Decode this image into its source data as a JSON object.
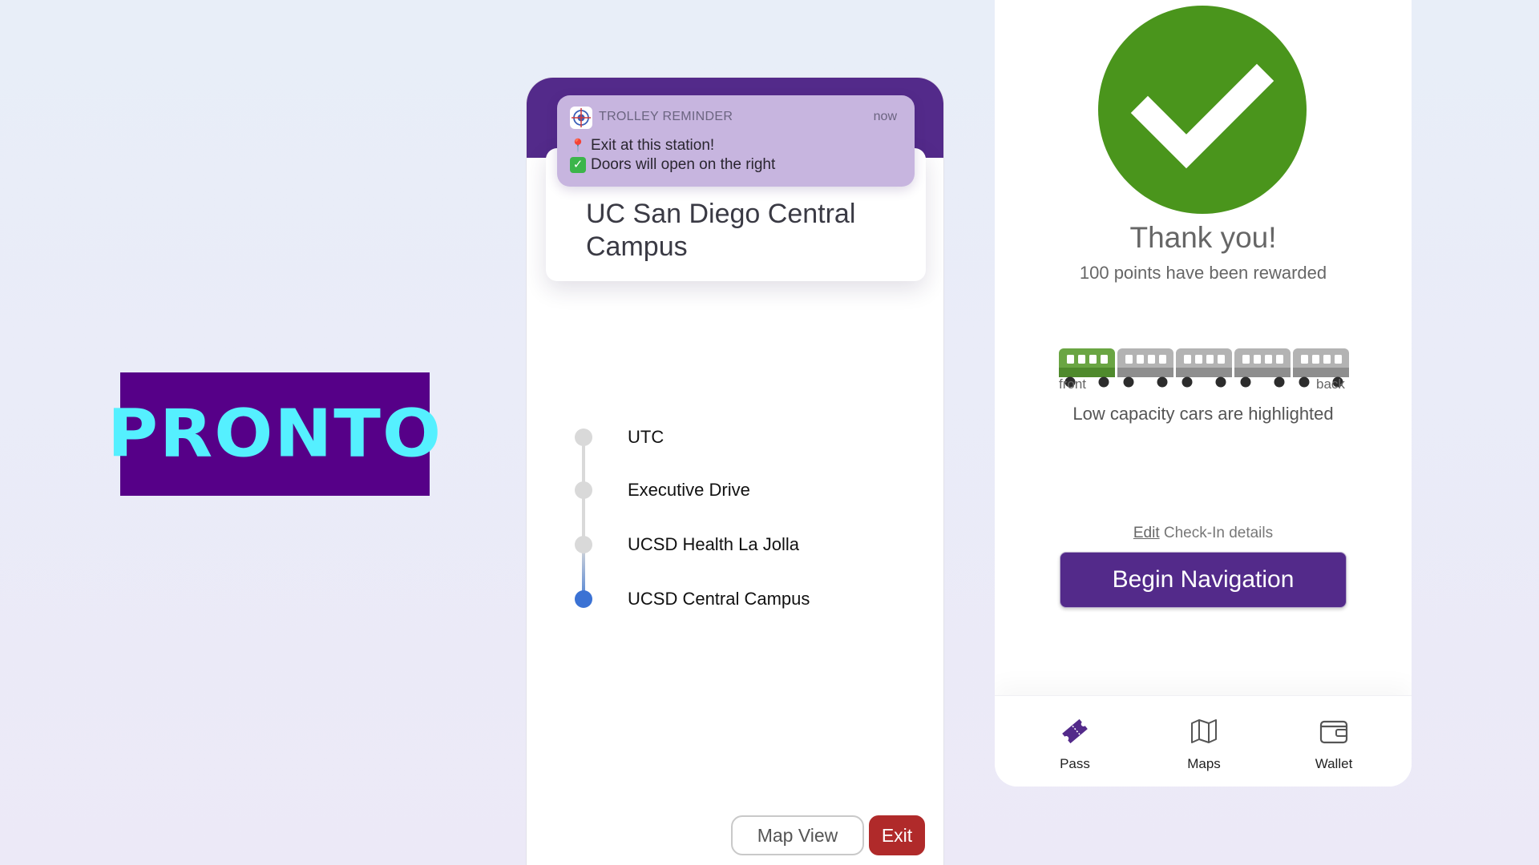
{
  "logo": {
    "text": "PRONTO"
  },
  "notification": {
    "app_name": "TROLLEY REMINDER",
    "time": "now",
    "line1": "Exit at this station!",
    "line2": "Doors will open on the right"
  },
  "station": {
    "name": "UC San Diego Central Campus"
  },
  "stops": [
    {
      "label": "UTC",
      "active": false
    },
    {
      "label": "Executive Drive",
      "active": false
    },
    {
      "label": "UCSD Health La Jolla",
      "active": false
    },
    {
      "label": "UCSD Central Campus",
      "active": true
    }
  ],
  "mid_buttons": {
    "map_view": "Map View",
    "exit": "Exit"
  },
  "confirmation": {
    "title": "Thank you!",
    "subtitle": "100 points have been rewarded",
    "train_front": "front",
    "train_back": "back",
    "capacity_note": "Low capacity cars are highlighted",
    "edit_link": "Edit",
    "edit_text": " Check-In details",
    "begin_navigation": "Begin Navigation"
  },
  "train_cars": [
    {
      "highlighted": true
    },
    {
      "highlighted": false
    },
    {
      "highlighted": false
    },
    {
      "highlighted": false
    },
    {
      "highlighted": false
    }
  ],
  "bottom_nav": [
    {
      "label": "Pass",
      "icon": "ticket-icon",
      "active": true
    },
    {
      "label": "Maps",
      "icon": "map-icon",
      "active": false
    },
    {
      "label": "Wallet",
      "icon": "wallet-icon",
      "active": false
    }
  ],
  "colors": {
    "brand_purple": "#532a8a",
    "logo_bg": "#560088",
    "logo_text": "#55f0ff",
    "success_green": "#4a951c",
    "exit_red": "#b02a2a",
    "active_stop_blue": "#3b72d4",
    "car_highlight": "#6aa543",
    "car_default": "#b3b3b3"
  }
}
